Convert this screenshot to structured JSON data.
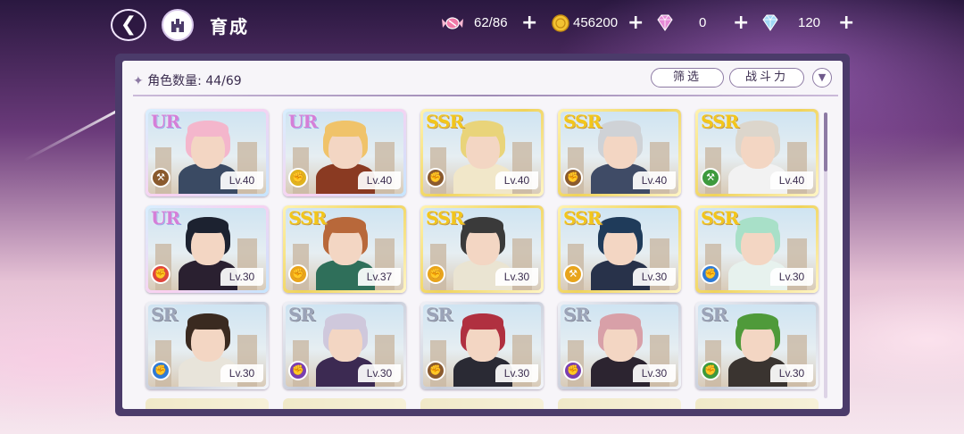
{
  "header": {
    "title": "育成",
    "resources": [
      {
        "icon": "candy-icon",
        "value": "62/86"
      },
      {
        "icon": "gold-coin-icon",
        "value": "456200"
      },
      {
        "icon": "pink-gem-icon",
        "value": "0"
      },
      {
        "icon": "blue-diamond-icon",
        "value": "120"
      }
    ]
  },
  "panel": {
    "count_label": "角色数量: 44/69",
    "filter_label": "筛选",
    "sort_label": "战斗力",
    "sort_direction_icon": "chevron-down-icon"
  },
  "cards": [
    {
      "rarity": "UR",
      "level": "Lv.40",
      "attr_color": "#8a5a2e",
      "attr_icon": "axe-icon"
    },
    {
      "rarity": "UR",
      "level": "Lv.40",
      "attr_color": "#e0b21e",
      "attr_icon": "fist-icon"
    },
    {
      "rarity": "SSR",
      "level": "Lv.40",
      "attr_color": "#8a5a2e",
      "attr_icon": "fist-icon"
    },
    {
      "rarity": "SSR",
      "level": "Lv.40",
      "attr_color": "#8a5a2e",
      "attr_icon": "fist-icon"
    },
    {
      "rarity": "SSR",
      "level": "Lv.40",
      "attr_color": "#3d9a3d",
      "attr_icon": "axe-icon"
    },
    {
      "rarity": "UR",
      "level": "Lv.30",
      "attr_color": "#e0463c",
      "attr_icon": "fist-icon"
    },
    {
      "rarity": "SSR",
      "level": "Lv.37",
      "attr_color": "#e8a41c",
      "attr_icon": "fist-icon"
    },
    {
      "rarity": "SSR",
      "level": "Lv.30",
      "attr_color": "#e8a41c",
      "attr_icon": "fist-icon"
    },
    {
      "rarity": "SSR",
      "level": "Lv.30",
      "attr_color": "#e8a41c",
      "attr_icon": "axe-icon"
    },
    {
      "rarity": "SSR",
      "level": "Lv.30",
      "attr_color": "#2f7bd6",
      "attr_icon": "fist-icon"
    },
    {
      "rarity": "SR",
      "level": "Lv.30",
      "attr_color": "#2f7bd6",
      "attr_icon": "fist-icon"
    },
    {
      "rarity": "SR",
      "level": "Lv.30",
      "attr_color": "#7a3fb0",
      "attr_icon": "fist-icon"
    },
    {
      "rarity": "SR",
      "level": "Lv.30",
      "attr_color": "#8a5a2e",
      "attr_icon": "fist-icon"
    },
    {
      "rarity": "SR",
      "level": "Lv.30",
      "attr_color": "#7a3fb0",
      "attr_icon": "fist-icon"
    },
    {
      "rarity": "SR",
      "level": "Lv.30",
      "attr_color": "#3d9a3d",
      "attr_icon": "fist-icon"
    }
  ],
  "card_art": [
    {
      "hair": "#f4b6cc",
      "outfit": "#3a4a63"
    },
    {
      "hair": "#f0c36a",
      "outfit": "#8a3a22"
    },
    {
      "hair": "#e9d47a",
      "outfit": "#f1e7c9"
    },
    {
      "hair": "#cfd2d6",
      "outfit": "#3f4b66"
    },
    {
      "hair": "#dcd6cc",
      "outfit": "#f2f2f2"
    },
    {
      "hair": "#1c2230",
      "outfit": "#2a2030"
    },
    {
      "hair": "#b8683a",
      "outfit": "#2f6f5a"
    },
    {
      "hair": "#3a3a3a",
      "outfit": "#eae4d2"
    },
    {
      "hair": "#1f3b5a",
      "outfit": "#28324a"
    },
    {
      "hair": "#a8e0c8",
      "outfit": "#e7f2ee"
    },
    {
      "hair": "#3a2a20",
      "outfit": "#e8e4da"
    },
    {
      "hair": "#cfc8dc",
      "outfit": "#3c2a52"
    },
    {
      "hair": "#b03040",
      "outfit": "#2a2a34"
    },
    {
      "hair": "#d8a0a8",
      "outfit": "#2c2430"
    },
    {
      "hair": "#4f9a3a",
      "outfit": "#3a3430"
    }
  ]
}
